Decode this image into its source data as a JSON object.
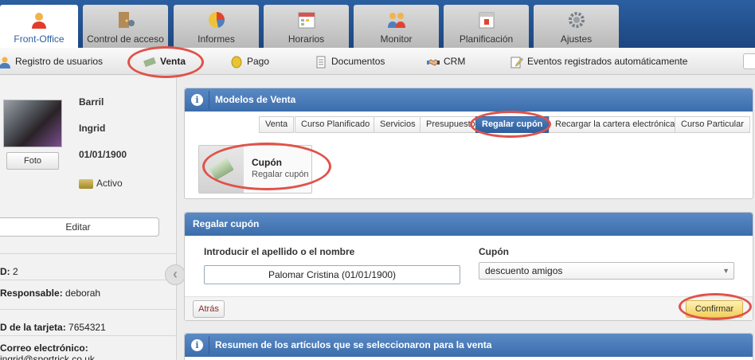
{
  "top_nav": [
    {
      "label": "Front-Office",
      "icon": "person-icon",
      "active": true
    },
    {
      "label": "Control de acceso",
      "icon": "access-control-icon",
      "active": false
    },
    {
      "label": "Informes",
      "icon": "pie-chart-icon",
      "active": false
    },
    {
      "label": "Horarios",
      "icon": "calendar-grid-icon",
      "active": false
    },
    {
      "label": "Monitor",
      "icon": "group-icon",
      "active": false
    },
    {
      "label": "Planificación",
      "icon": "calendar-icon",
      "active": false
    },
    {
      "label": "Ajustes",
      "icon": "gear-icon",
      "active": false
    }
  ],
  "sub_nav": [
    {
      "label": "Registro de usuarios",
      "icon": "user-icon"
    },
    {
      "label": "Venta",
      "icon": "money-icon"
    },
    {
      "label": "Pago",
      "icon": "coin-icon"
    },
    {
      "label": "Documentos",
      "icon": "document-icon"
    },
    {
      "label": "CRM",
      "icon": "handshake-icon"
    },
    {
      "label": "Eventos registrados automáticamente",
      "icon": "edit-icon"
    }
  ],
  "member": {
    "last_name": "Barril",
    "first_name": "Ingrid",
    "birthdate": "01/01/1900",
    "status": "Activo",
    "photo_button": "Foto",
    "edit_button": "Editar",
    "id_label": "D:",
    "id_value": "2",
    "responsable_label": "Responsable:",
    "responsable_value": "deborah",
    "card_label": "D de la tarjeta:",
    "card_value": "7654321",
    "email_label": "Correo electrónico:",
    "email_value": "ingrid@sportrick.co.uk"
  },
  "modelos_panel": {
    "title": "Modelos de Venta",
    "tabs": [
      "Venta",
      "Curso Planificado",
      "Servicios",
      "Presupuesto",
      "Regalar cupón",
      "Recargar la cartera electrónica",
      "Curso Particular"
    ],
    "active_tab": "Regalar cupón",
    "card": {
      "title": "Cupón",
      "subtitle": "Regalar cupón"
    }
  },
  "regalar_panel": {
    "title": "Regalar cupón",
    "name_label": "Introducir el apellido o el nombre",
    "name_value": "Palomar Cristina (01/01/1900)",
    "cupon_label": "Cupón",
    "cupon_value": "descuento amigos",
    "back_button": "Atrás",
    "confirm_button": "Confirmar"
  },
  "resumen_panel": {
    "title": "Resumen de los artículos que se seleccionaron para la venta"
  },
  "colors": {
    "nav_blue": "#1d4680",
    "panel_header": "#3c6eac",
    "highlight": "#e0524a",
    "confirm_yellow": "#f2cf5a"
  }
}
